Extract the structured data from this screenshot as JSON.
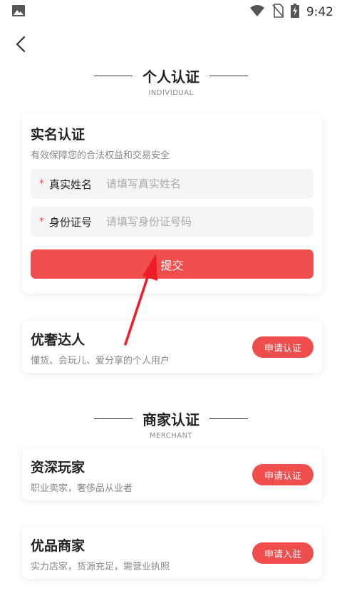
{
  "status_bar": {
    "time": "9:42"
  },
  "individual": {
    "title": "个人认证",
    "subtitle": "INDIVIDUAL",
    "real_name": {
      "title": "实名认证",
      "desc": "有效保障您的合法权益和交易安全",
      "fields": [
        {
          "required_mark": "*",
          "label": "真实姓名",
          "placeholder": "请填写真实姓名"
        },
        {
          "required_mark": "*",
          "label": "身份证号",
          "placeholder": "请填写身份证号码"
        }
      ],
      "submit_label": "提交"
    },
    "luxury_expert": {
      "title": "优奢达人",
      "desc": "懂货、会玩儿、爱分享的个人用户",
      "button_label": "申请认证"
    }
  },
  "merchant": {
    "title": "商家认证",
    "subtitle": "MERCHANT",
    "senior_player": {
      "title": "资深玩家",
      "desc": "职业卖家，奢侈品从业者",
      "button_label": "申请认证"
    },
    "quality_merchant": {
      "title": "优品商家",
      "desc": "实力店家，货源充足，需营业执照",
      "button_label": "申请入驻"
    }
  },
  "colors": {
    "accent": "#f04d4d",
    "annotation_arrow": "#ee1c25"
  }
}
